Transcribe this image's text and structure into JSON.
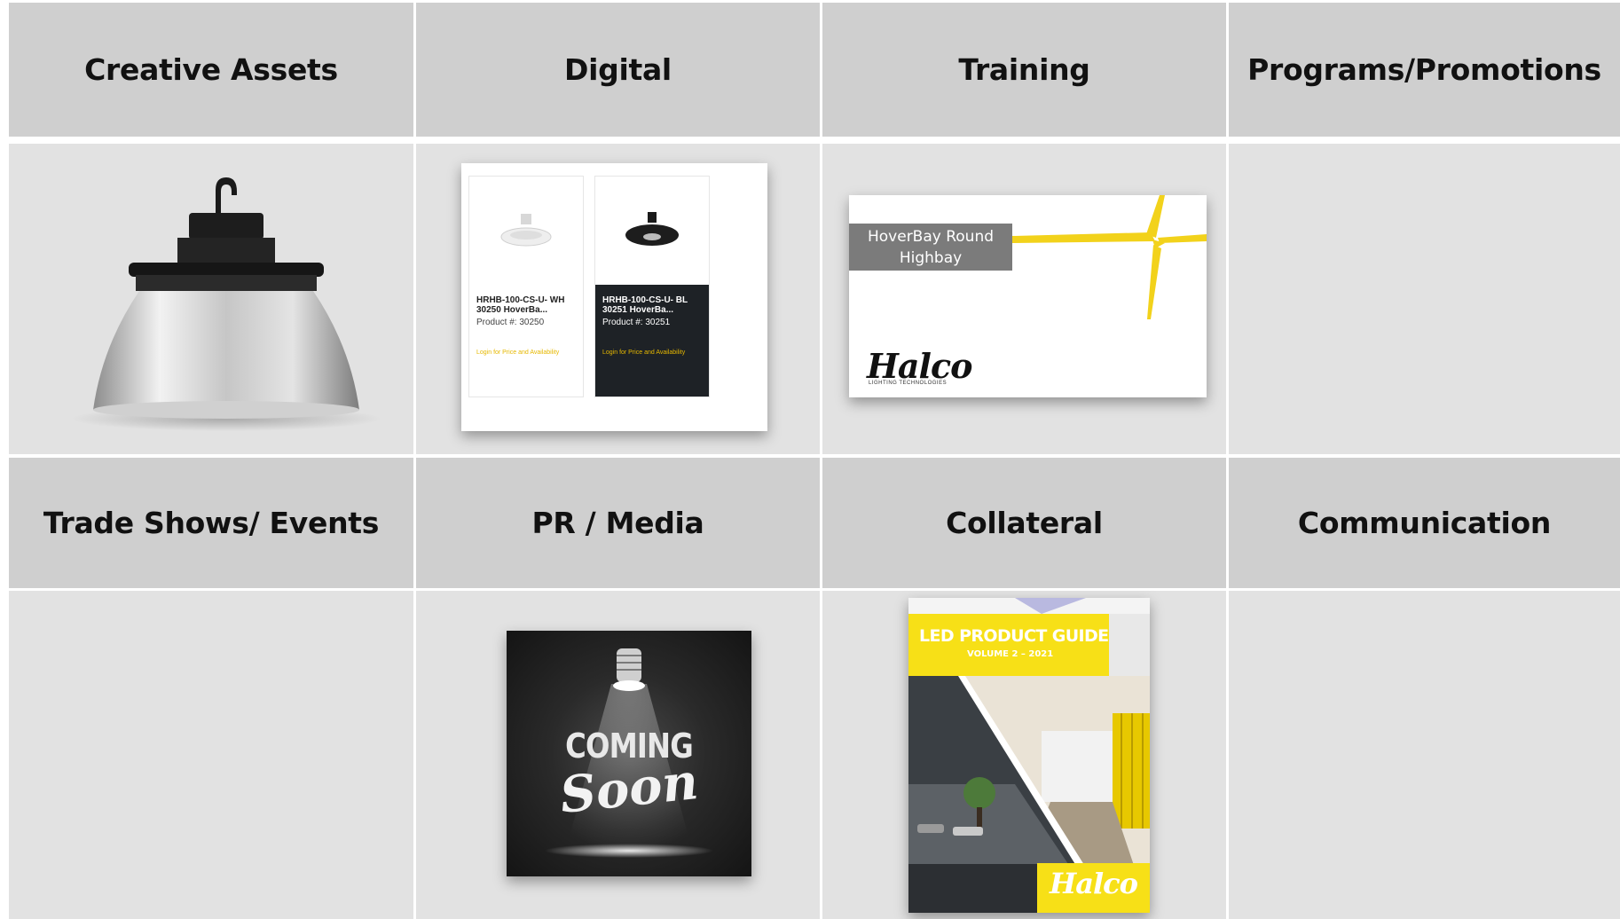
{
  "tiles": {
    "creative_assets": "Creative Assets",
    "digital": "Digital",
    "training": "Training",
    "programs_promotions": "Programs/Promotions",
    "trade_shows_events": "Trade Shows/ Events",
    "pr_media": "PR / Media",
    "collateral": "Collateral",
    "communication": "Communication"
  },
  "digital_card": {
    "products": [
      {
        "name": "HRHB-100-CS-U- WH 30250 HoverBa...",
        "product_number": "Product #: 30250",
        "login": "Login for Price and Availability"
      },
      {
        "name": "HRHB-100-CS-U- BL 30251 HoverBa...",
        "product_number": "Product #: 30251",
        "login": "Login for Price and Availability"
      }
    ]
  },
  "training_card": {
    "tag": "HoverBay Round Highbay",
    "logo": "Halco",
    "logo_sub": "LIGHTING TECHNOLOGIES"
  },
  "coming_soon": {
    "line1": "COMING",
    "line2": "Soon"
  },
  "guide": {
    "title": "LED PRODUCT GUIDE",
    "subtitle": "VOLUME 2 – 2021",
    "logo": "Halco"
  },
  "colors": {
    "header_bg": "#cfcfcf",
    "body_bg": "#e2e2e2",
    "brand_yellow": "#f7e017",
    "divider": "#ffffff"
  },
  "icons": [
    "highbay-lamp-image",
    "coming-soon-spotlight-image",
    "product-guide-cover-image"
  ]
}
